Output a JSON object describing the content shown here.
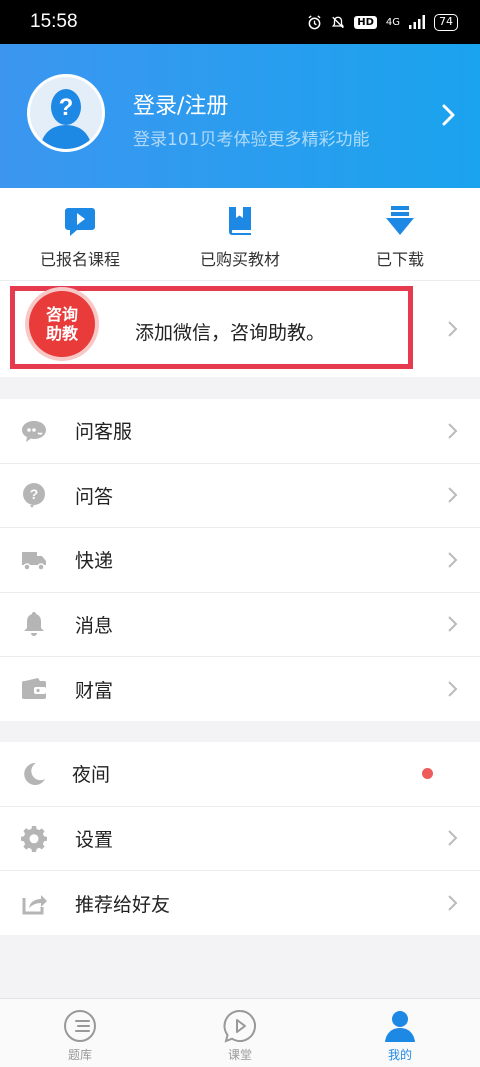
{
  "status_bar": {
    "time": "15:58",
    "hd": "HD",
    "network": "4G",
    "battery": "74"
  },
  "header": {
    "title": "登录/注册",
    "subtitle": "登录101贝考体验更多精彩功能"
  },
  "quick_actions": [
    {
      "label": "已报名课程",
      "icon": "video-play-icon"
    },
    {
      "label": "已购买教材",
      "icon": "book-icon"
    },
    {
      "label": "已下载",
      "icon": "download-icon"
    }
  ],
  "promo": {
    "badge_line1": "咨询",
    "badge_line2": "助教",
    "text": "添加微信，咨询助教。"
  },
  "menu_group1": [
    {
      "label": "问客服",
      "icon": "customer-service-icon"
    },
    {
      "label": "问答",
      "icon": "question-icon"
    },
    {
      "label": "快递",
      "icon": "truck-icon"
    },
    {
      "label": "消息",
      "icon": "bell-icon"
    },
    {
      "label": "财富",
      "icon": "wallet-icon"
    }
  ],
  "menu_group2": [
    {
      "label": "夜间",
      "icon": "moon-icon"
    },
    {
      "label": "设置",
      "icon": "gear-icon"
    },
    {
      "label": "推荐给好友",
      "icon": "share-icon"
    }
  ],
  "tab_bar": [
    {
      "label": "题库",
      "icon": "question-bank-icon",
      "active": false
    },
    {
      "label": "课堂",
      "icon": "classroom-play-icon",
      "active": false
    },
    {
      "label": "我的",
      "icon": "profile-icon",
      "active": true
    }
  ],
  "colors": {
    "header_start": "#3c96f0",
    "header_end": "#1aa3ee",
    "accent_blue": "#1e88e5",
    "promo_border": "#e63a4f",
    "badge_red": "#e83b3a",
    "night_dot": "#ee5b5b"
  }
}
